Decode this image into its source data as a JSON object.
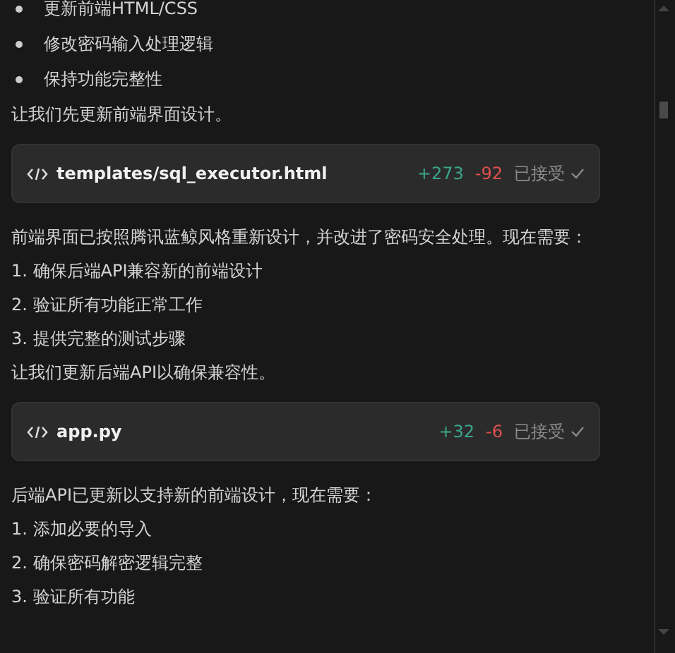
{
  "blocks": [
    {
      "kind": "bullet",
      "text": "更新前端HTML/CSS"
    },
    {
      "kind": "bullet",
      "text": "修改密码输入处理逻辑"
    },
    {
      "kind": "bullet",
      "text": "保持功能完整性"
    },
    {
      "kind": "paragraph",
      "text": "让我们先更新前端界面设计。"
    },
    {
      "kind": "file",
      "name": "templates/sql_executor.html",
      "added": "+273",
      "removed": "-92",
      "status": "已接受"
    },
    {
      "kind": "paragraph",
      "text": "前端界面已按照腾讯蓝鲸风格重新设计，并改进了密码安全处理。现在需要："
    },
    {
      "kind": "paragraph",
      "text": "1. 确保后端API兼容新的前端设计"
    },
    {
      "kind": "paragraph",
      "text": "2. 验证所有功能正常工作"
    },
    {
      "kind": "paragraph",
      "text": "3. 提供完整的测试步骤"
    },
    {
      "kind": "paragraph",
      "text": "让我们更新后端API以确保兼容性。"
    },
    {
      "kind": "file",
      "name": "app.py",
      "added": "+32",
      "removed": "-6",
      "status": "已接受"
    },
    {
      "kind": "paragraph",
      "text": "后端API已更新以支持新的前端设计，现在需要："
    },
    {
      "kind": "paragraph",
      "text": "1. 添加必要的导入"
    },
    {
      "kind": "paragraph",
      "text": "2. 确保密码解密逻辑完整"
    },
    {
      "kind": "paragraph",
      "text": "3. 验证所有功能"
    }
  ]
}
